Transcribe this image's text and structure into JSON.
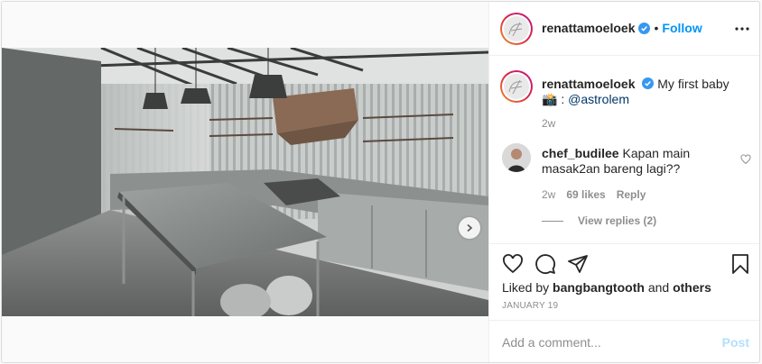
{
  "header": {
    "username": "renattamoeloek",
    "verified": true,
    "separator": "•",
    "follow_label": "Follow",
    "more_icon": "more-horizontal-icon"
  },
  "caption": {
    "username": "renattamoeloek",
    "text": "My first baby",
    "line2_prefix": "📸 : ",
    "mention": "@astrolem",
    "time": "2w"
  },
  "comment": {
    "username": "chef_budilee",
    "text": "Kapan main masak2an bareng lagi??",
    "time": "2w",
    "likes": "69 likes",
    "reply_label": "Reply",
    "view_replies": "View replies (2)"
  },
  "actions": {
    "icons": [
      "heart-icon",
      "comment-icon",
      "share-icon",
      "bookmark-icon"
    ],
    "liked_by_prefix": "Liked by",
    "liked_by_user": "bangbangtooth",
    "liked_by_and": "and",
    "liked_by_others": "others",
    "date": "JANUARY 19"
  },
  "composer": {
    "placeholder": "Add a comment...",
    "post_label": "Post"
  },
  "carousel": {
    "slides": 5,
    "active_index": 0
  },
  "colors": {
    "link_blue": "#0095f6",
    "mention_blue": "#00376b",
    "muted": "#8e8e8e",
    "post_disabled": "#b2dffc"
  }
}
